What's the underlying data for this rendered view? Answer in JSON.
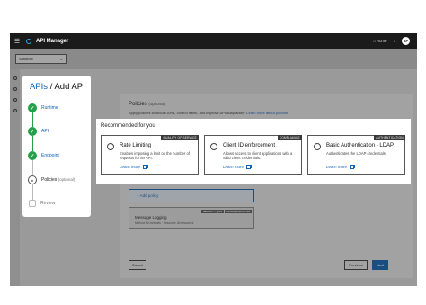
{
  "app": {
    "title": "API Manager",
    "org": "Acme",
    "avatar_initials": "AP",
    "help": "?"
  },
  "environment": {
    "selected": "Sandbox"
  },
  "wizard": {
    "title_link": "APIs",
    "title_rest": " / Add API",
    "steps": [
      {
        "label": "Runtime",
        "state": "done"
      },
      {
        "label": "API",
        "state": "done"
      },
      {
        "label": "Endpoint",
        "state": "done"
      },
      {
        "label": "Policies",
        "optional": "(optional)",
        "state": "current"
      },
      {
        "label": "Review",
        "state": "todo"
      }
    ]
  },
  "main": {
    "policies_title": "Policies",
    "policies_optional": "(optional)",
    "description": "Apply policies to secure APIs, control traffic, and improve API adaptability.",
    "description_link": "Learn more about policies",
    "add_policy": "+ Add policy",
    "policy_card": {
      "name": "Message Logging",
      "tags": [
        "SECURITY / QOS",
        "TROUBLESHOOTING"
      ],
      "subtitle": "Method: All methods · Resource: All resources"
    },
    "cancel": "Cancel",
    "previous": "Previous",
    "next": "Next"
  },
  "recommendations": {
    "title": "Recommended for you",
    "cards": [
      {
        "name": "Rate Limiting",
        "tag": "QUALITY OF SERVICE",
        "description": "Enables imposing a limit on the number of requests for an API.",
        "link": "Learn more"
      },
      {
        "name": "Client ID enforcement",
        "tag": "COMPLIANCE",
        "description": "Allows access to client applications with a valid client credentials.",
        "link": "Learn more"
      },
      {
        "name": "Basic Authentication - LDAP",
        "tag": "AUTHENTICATION",
        "description": "Authenticates the LDAP credentials.",
        "link": "Learn more"
      }
    ]
  },
  "colors": {
    "accent": "#0f62b4",
    "success": "#24a148",
    "topbar": "#1b1b1b"
  }
}
